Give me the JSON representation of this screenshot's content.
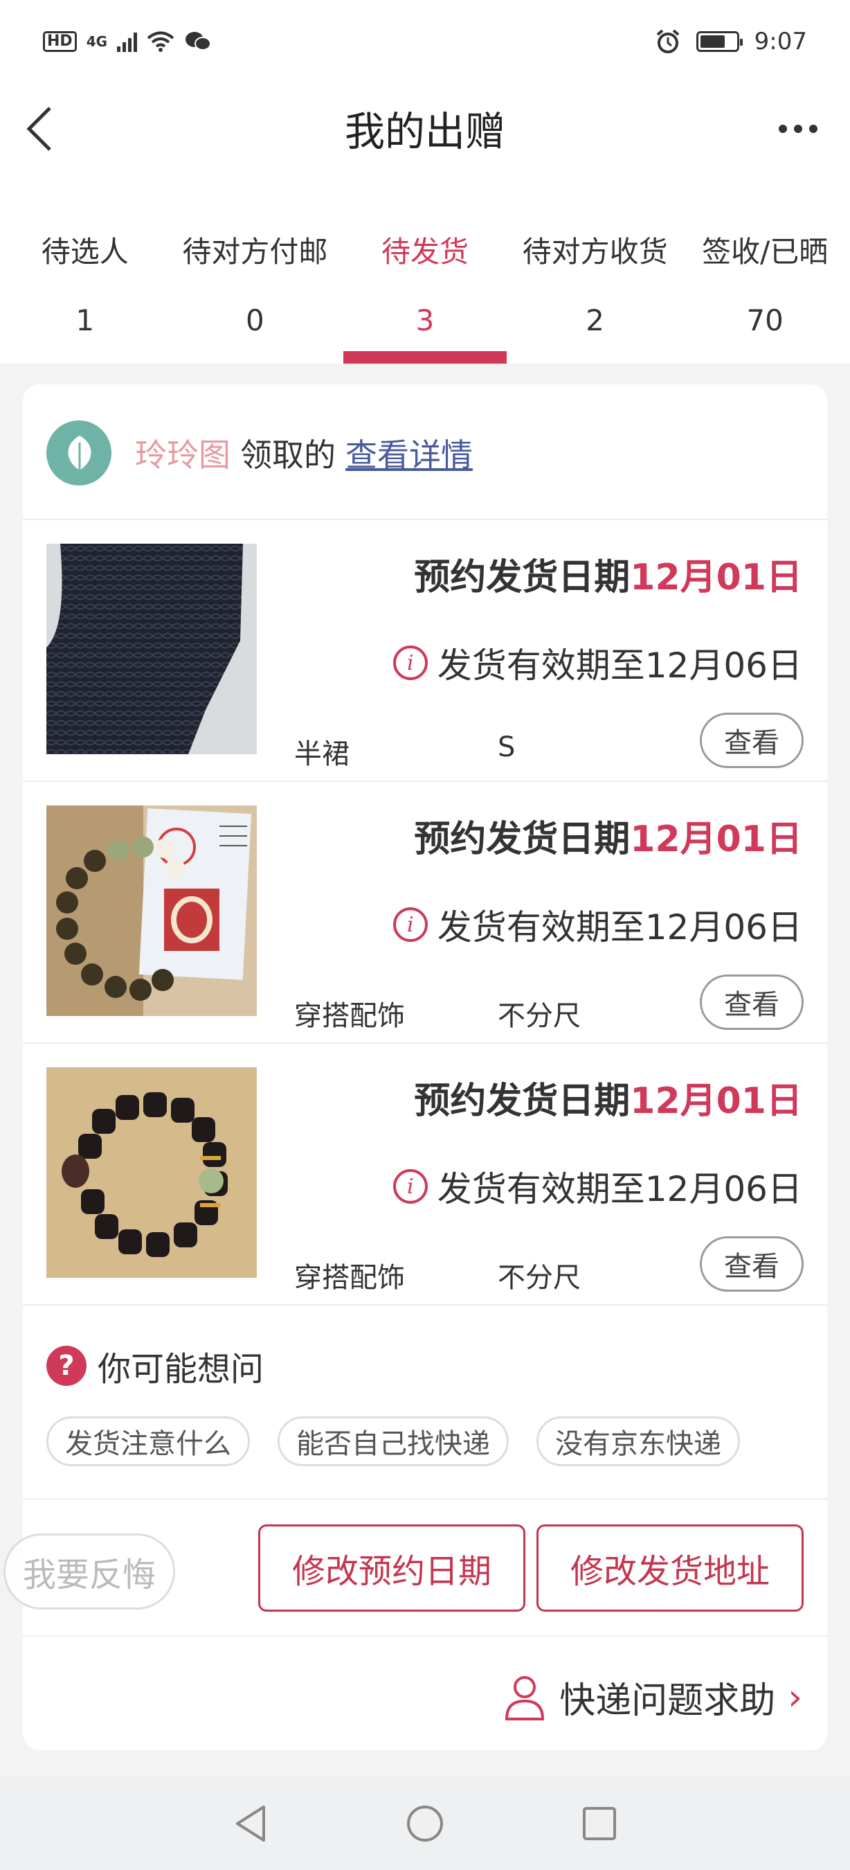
{
  "status_bar": {
    "hd": "HD",
    "signal": "4G",
    "time": "9:07"
  },
  "header": {
    "title": "我的出赠",
    "back_icon": "chevron-left-icon",
    "more_icon": "more-dots-icon"
  },
  "tabs": [
    {
      "label": "待选人",
      "count": "1"
    },
    {
      "label": "待对方付邮",
      "count": "0"
    },
    {
      "label": "待发货",
      "count": "3",
      "active": true
    },
    {
      "label": "待对方收货",
      "count": "2"
    },
    {
      "label": "签收/已晒",
      "count": "70"
    }
  ],
  "order": {
    "user_name": "玲玲图",
    "claim_label": "领取的",
    "detail_link": "查看详情",
    "items": [
      {
        "ship_label": "预约发货日期",
        "ship_date": "12月01日",
        "valid_text": "发货有效期至12月06日",
        "category": "半裙",
        "size": "S",
        "view_label": "查看"
      },
      {
        "ship_label": "预约发货日期",
        "ship_date": "12月01日",
        "valid_text": "发货有效期至12月06日",
        "category": "穿搭配饰",
        "size": "不分尺",
        "view_label": "查看"
      },
      {
        "ship_label": "预约发货日期",
        "ship_date": "12月01日",
        "valid_text": "发货有效期至12月06日",
        "category": "穿搭配饰",
        "size": "不分尺",
        "view_label": "查看"
      }
    ]
  },
  "faq": {
    "title": "你可能想问",
    "chips": [
      "发货注意什么",
      "能否自己找快递",
      "没有京东快递"
    ]
  },
  "actions": {
    "regret": "我要反悔",
    "change_date": "修改预约日期",
    "change_address": "修改发货地址"
  },
  "help": {
    "label": "快递问题求助"
  },
  "colors": {
    "accent": "#d0395a",
    "link": "#4a5a9a",
    "user_name": "#e89aa0"
  }
}
